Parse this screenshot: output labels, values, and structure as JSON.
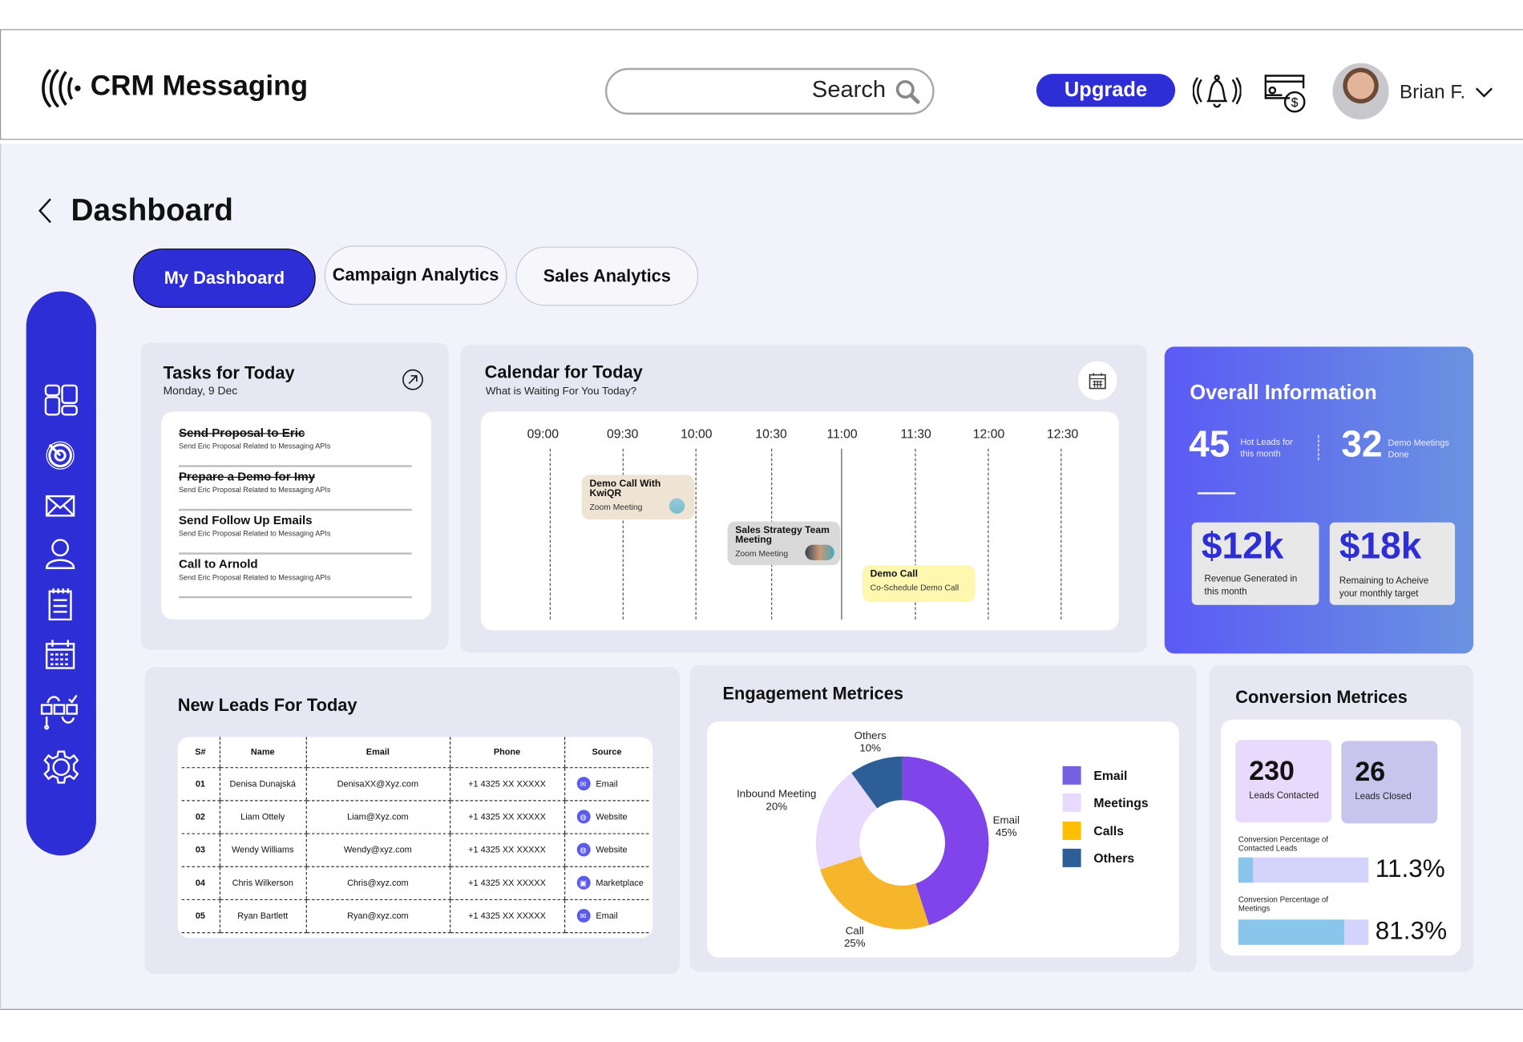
{
  "header": {
    "app_title": "CRM Messaging",
    "search_placeholder": "Search",
    "upgrade_label": "Upgrade",
    "user_name": "Brian F."
  },
  "page": {
    "title": "Dashboard"
  },
  "tabs": [
    {
      "label": "My Dashboard",
      "active": true
    },
    {
      "label": "Campaign Analytics"
    },
    {
      "label": "Sales Analytics"
    }
  ],
  "sidebar": {
    "icons": [
      "dashboard-icon",
      "target-icon",
      "mail-icon",
      "user-icon",
      "notes-icon",
      "calendar-icon",
      "workflow-icon",
      "settings-icon"
    ]
  },
  "tasks": {
    "title": "Tasks for Today",
    "date": "Monday, 9 Dec",
    "items": [
      {
        "title": "Send Proposal to Eric",
        "subtitle": "Send Eric Proposal Related to Messaging APIs",
        "done": true,
        "icon": "check-icon"
      },
      {
        "title": "Prepare a Demo for Imy",
        "subtitle": "Send Eric Proposal Related to Messaging APIs",
        "done": true,
        "icon": "check-icon"
      },
      {
        "title": "Send Follow Up Emails",
        "subtitle": "Send Eric Proposal Related to Messaging APIs",
        "done": false,
        "icon": "mail-icon"
      },
      {
        "title": "Call to  Arnold",
        "subtitle": "Send Eric Proposal Related to Messaging APIs",
        "done": false,
        "icon": "phone-icon"
      }
    ]
  },
  "calendar": {
    "title": "Calendar for Today",
    "subtitle": "What is Waiting For You Today?",
    "times": [
      "09:00",
      "09:30",
      "10:00",
      "10:30",
      "11:00",
      "11:30",
      "12:00",
      "12:30"
    ],
    "events": [
      {
        "title": "Demo Call With KwiQR",
        "type": "Zoom Meeting",
        "color": "#efe3d3"
      },
      {
        "title": "Sales Strategy Team Meeting",
        "type": "Zoom Meeting",
        "color": "#d9d9d9"
      },
      {
        "title": "Demo Call",
        "type": "Co-Schedule Demo Call",
        "color": "#fdf7b0"
      }
    ]
  },
  "overall": {
    "title": "Overall Information",
    "hot_leads": "45",
    "hot_leads_label": "Hot Leads for this month",
    "demos": "32",
    "demos_label": "Demo Meetings Done",
    "revenue": "$12k",
    "revenue_label": "Revenue Generated in this month",
    "remaining": "$18k",
    "remaining_label": "Remaining to Acheive your monthly target"
  },
  "leads": {
    "title": "New Leads For Today",
    "columns": [
      "S#",
      "Name",
      "Email",
      "Phone",
      "Source"
    ],
    "rows": [
      [
        "01",
        "Denisa Dunajská",
        "DenisaXX@Xyz.com",
        "+1 4325 XX XXXXX",
        "Email"
      ],
      [
        "02",
        "Liam Ottely",
        "Liam@Xyz.com",
        "+1 4325 XX XXXXX",
        "Website"
      ],
      [
        "03",
        "Wendy Williams",
        "Wendy@xyz.com",
        "+1 4325 XX XXXXX",
        "Website"
      ],
      [
        "04",
        "Chris Wilkerson",
        "Chris@xyz.com",
        "+1 4325 XX XXXXX",
        "Marketplace"
      ],
      [
        "05",
        "Ryan Bartlett",
        "Ryan@xyz.com",
        "+1 4325 XX XXXXX",
        "Email"
      ]
    ]
  },
  "engagement": {
    "title": "Engagement  Metrices"
  },
  "chart_data": {
    "type": "pie",
    "donut": true,
    "slices": [
      {
        "label": "Email",
        "pct": "45%",
        "value": 45,
        "color": "#7f45ea"
      },
      {
        "label": "Call",
        "pct": "25%",
        "value": 25,
        "color": "#f5b62b"
      },
      {
        "label": "Inbound Meeting",
        "pct": "20%",
        "value": 20,
        "color": "#e7dafd"
      },
      {
        "label": "Others",
        "pct": "10%",
        "value": 10,
        "color": "#2d5e96"
      }
    ],
    "legend": [
      {
        "label": "Email",
        "color": "#7460e3"
      },
      {
        "label": "Meetings",
        "color": "#e7dafd"
      },
      {
        "label": "Calls",
        "color": "#fdbf00"
      },
      {
        "label": "Others",
        "color": "#2d5e96"
      }
    ],
    "legend_position": "right"
  },
  "conversion": {
    "title": "Conversion Metrices",
    "contacted": "230",
    "contacted_label": "Leads Contacted",
    "closed": "26",
    "closed_label": "Leads Closed",
    "bars": [
      {
        "label": "Conversion Percentage of Contacted Leads",
        "value": "11.3%",
        "fill": 11.3
      },
      {
        "label": "Conversion Percentage of Meetings",
        "value": "81.3%",
        "fill": 81.3
      }
    ]
  },
  "colors": {
    "accent": "#2e2ed6",
    "card": "#e7e7f3",
    "page_bg": "#f2f2fb"
  }
}
